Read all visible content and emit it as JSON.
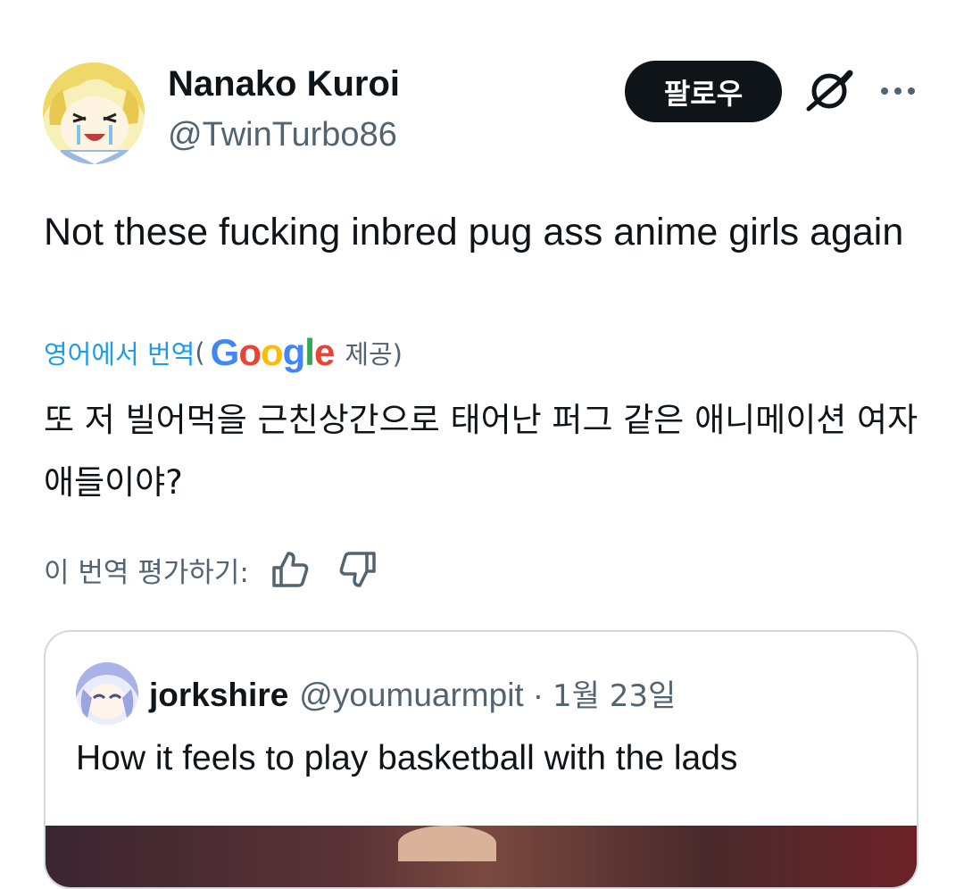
{
  "author": {
    "name": "Nanako Kuroi",
    "handle": "@TwinTurbo86"
  },
  "header": {
    "follow_label": "팔로우"
  },
  "icons": {
    "grok": "grok-icon",
    "more": "more-dots-icon",
    "thumbs_up": "thumbs-up-icon",
    "thumbs_down": "thumbs-down-icon"
  },
  "tweet": {
    "text": "Not these fucking inbred pug ass anime girls again"
  },
  "translation": {
    "link_label": "영어에서 번역",
    "open_paren": "(",
    "google_logo": "Google",
    "provider_suffix": "제공)",
    "text": "또 저 빌어먹을 근친상간으로 태어난 퍼그 같은 애니메이션 여자애들이야?",
    "rate_label": "이 번역 평가하기:"
  },
  "quote": {
    "name": "jorkshire",
    "handle": "@youmuarmpit",
    "separator": "·",
    "date": "1월 23일",
    "text": "How it feels to play basketball with the lads"
  },
  "colors": {
    "text_primary": "#0f1419",
    "text_secondary": "#536471",
    "link": "#1d9bf0",
    "border": "#cfd9de",
    "button_bg": "#0f1419"
  }
}
